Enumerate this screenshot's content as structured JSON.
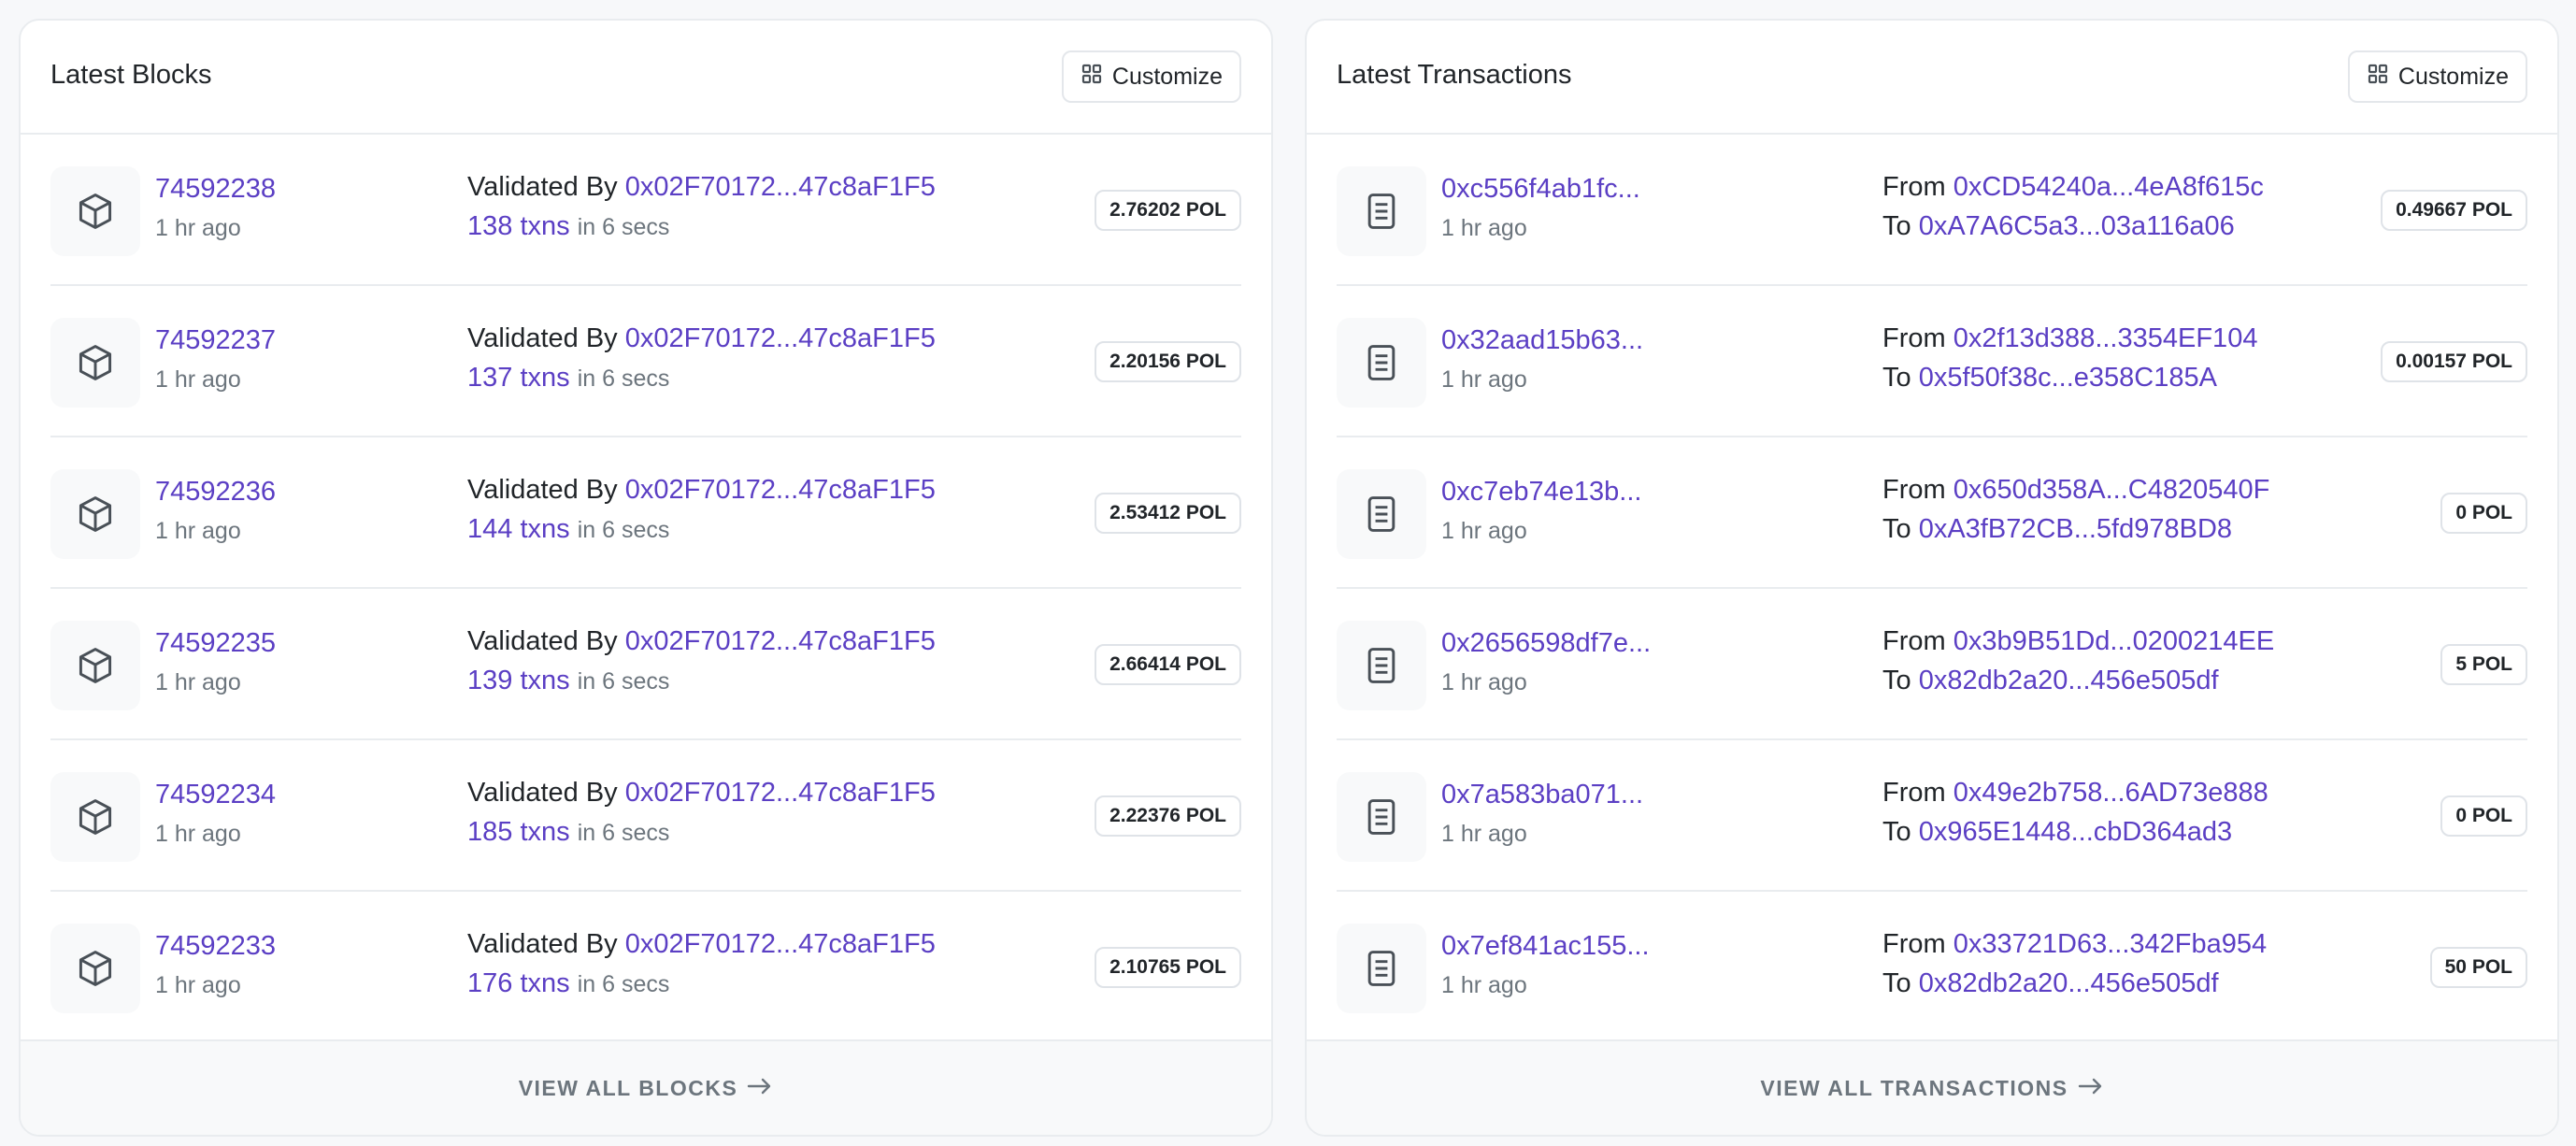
{
  "blocks": {
    "title": "Latest Blocks",
    "customize_label": "Customize",
    "footer_label": "VIEW ALL BLOCKS",
    "rows": [
      {
        "number": "74592238",
        "age": "1 hr ago",
        "validated_prefix": "Validated By",
        "validator": "0x02F70172...47c8aF1F5",
        "txns": "138 txns",
        "duration": "in 6 secs",
        "reward": "2.76202 POL"
      },
      {
        "number": "74592237",
        "age": "1 hr ago",
        "validated_prefix": "Validated By",
        "validator": "0x02F70172...47c8aF1F5",
        "txns": "137 txns",
        "duration": "in 6 secs",
        "reward": "2.20156 POL"
      },
      {
        "number": "74592236",
        "age": "1 hr ago",
        "validated_prefix": "Validated By",
        "validator": "0x02F70172...47c8aF1F5",
        "txns": "144 txns",
        "duration": "in 6 secs",
        "reward": "2.53412 POL"
      },
      {
        "number": "74592235",
        "age": "1 hr ago",
        "validated_prefix": "Validated By",
        "validator": "0x02F70172...47c8aF1F5",
        "txns": "139 txns",
        "duration": "in 6 secs",
        "reward": "2.66414 POL"
      },
      {
        "number": "74592234",
        "age": "1 hr ago",
        "validated_prefix": "Validated By",
        "validator": "0x02F70172...47c8aF1F5",
        "txns": "185 txns",
        "duration": "in 6 secs",
        "reward": "2.22376 POL"
      },
      {
        "number": "74592233",
        "age": "1 hr ago",
        "validated_prefix": "Validated By",
        "validator": "0x02F70172...47c8aF1F5",
        "txns": "176 txns",
        "duration": "in 6 secs",
        "reward": "2.10765 POL"
      }
    ]
  },
  "transactions": {
    "title": "Latest Transactions",
    "customize_label": "Customize",
    "footer_label": "VIEW ALL TRANSACTIONS",
    "from_label": "From",
    "to_label": "To",
    "rows": [
      {
        "hash": "0xc556f4ab1fc...",
        "age": "1 hr ago",
        "from": "0xCD54240a...4eA8f615c",
        "to": "0xA7A6C5a3...03a116a06",
        "value": "0.49667 POL"
      },
      {
        "hash": "0x32aad15b63...",
        "age": "1 hr ago",
        "from": "0x2f13d388...3354EF104",
        "to": "0x5f50f38c...e358C185A",
        "value": "0.00157 POL"
      },
      {
        "hash": "0xc7eb74e13b...",
        "age": "1 hr ago",
        "from": "0x650d358A...C4820540F",
        "to": "0xA3fB72CB...5fd978BD8",
        "value": "0 POL"
      },
      {
        "hash": "0x2656598df7e...",
        "age": "1 hr ago",
        "from": "0x3b9B51Dd...0200214EE",
        "to": "0x82db2a20...456e505df",
        "value": "5 POL"
      },
      {
        "hash": "0x7a583ba071...",
        "age": "1 hr ago",
        "from": "0x49e2b758...6AD73e888",
        "to": "0x965E1448...cbD364ad3",
        "value": "0 POL"
      },
      {
        "hash": "0x7ef841ac155...",
        "age": "1 hr ago",
        "from": "0x33721D63...342Fba954",
        "to": "0x82db2a20...456e505df",
        "value": "50 POL"
      }
    ]
  },
  "icons": {
    "block": "cube-icon",
    "transaction": "document-icon",
    "customize": "grid-icon",
    "arrow": "arrow-right-icon"
  },
  "colors": {
    "link": "#5b3fc4",
    "muted": "#6c757d",
    "border": "#e9ecef"
  }
}
